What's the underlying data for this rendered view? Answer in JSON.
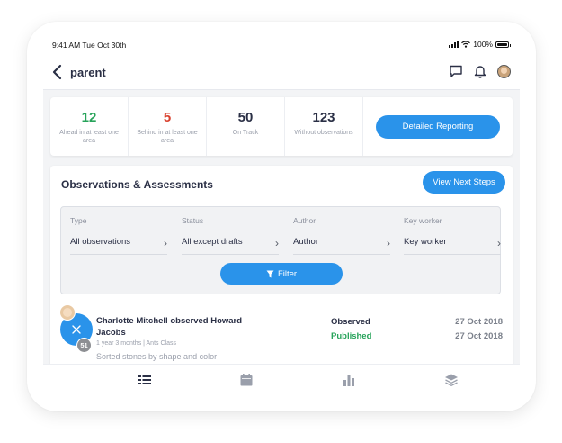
{
  "status_bar": {
    "time": "9:41 AM  Tue Oct 30th",
    "battery": "100%"
  },
  "header": {
    "title": "parent",
    "icons": [
      "back-chevron-icon",
      "chat-icon",
      "bell-icon",
      "avatar"
    ]
  },
  "stats": [
    {
      "value": "12",
      "label": "Ahead in at least one area",
      "color": "#27a35a"
    },
    {
      "value": "5",
      "label": "Behind in at least one area",
      "color": "#d9412e"
    },
    {
      "value": "50",
      "label": "On Track",
      "color": "#2a2f45"
    },
    {
      "value": "123",
      "label": "Without observations",
      "color": "#2a2f45"
    }
  ],
  "report_button": "Detailed Reporting",
  "observations": {
    "title": "Observations & Assessments",
    "next_steps_button": "View Next Steps",
    "filters": [
      {
        "label": "Type",
        "value": "All observations"
      },
      {
        "label": "Status",
        "value": "All except drafts"
      },
      {
        "label": "Author",
        "value": "Author"
      },
      {
        "label": "Key worker",
        "value": "Key worker"
      }
    ],
    "filter_button": "Filter",
    "items": [
      {
        "headline": "Charlotte Mitchell observed Howard Jacobs",
        "meta": "1 year 3 months  |  Ants Class",
        "description": "Sorted stones by shape and color",
        "count": "51",
        "status_1": "Observed",
        "status_2": "Published",
        "date_1": "27 Oct 2018",
        "date_2": "27 Oct 2018"
      }
    ]
  },
  "colors": {
    "accent": "#2a93ea",
    "observed": "#2a2f45",
    "published": "#27a35a"
  },
  "tab_bar": [
    "list-icon",
    "calendar-icon",
    "bar-chart-icon",
    "layers-icon"
  ]
}
